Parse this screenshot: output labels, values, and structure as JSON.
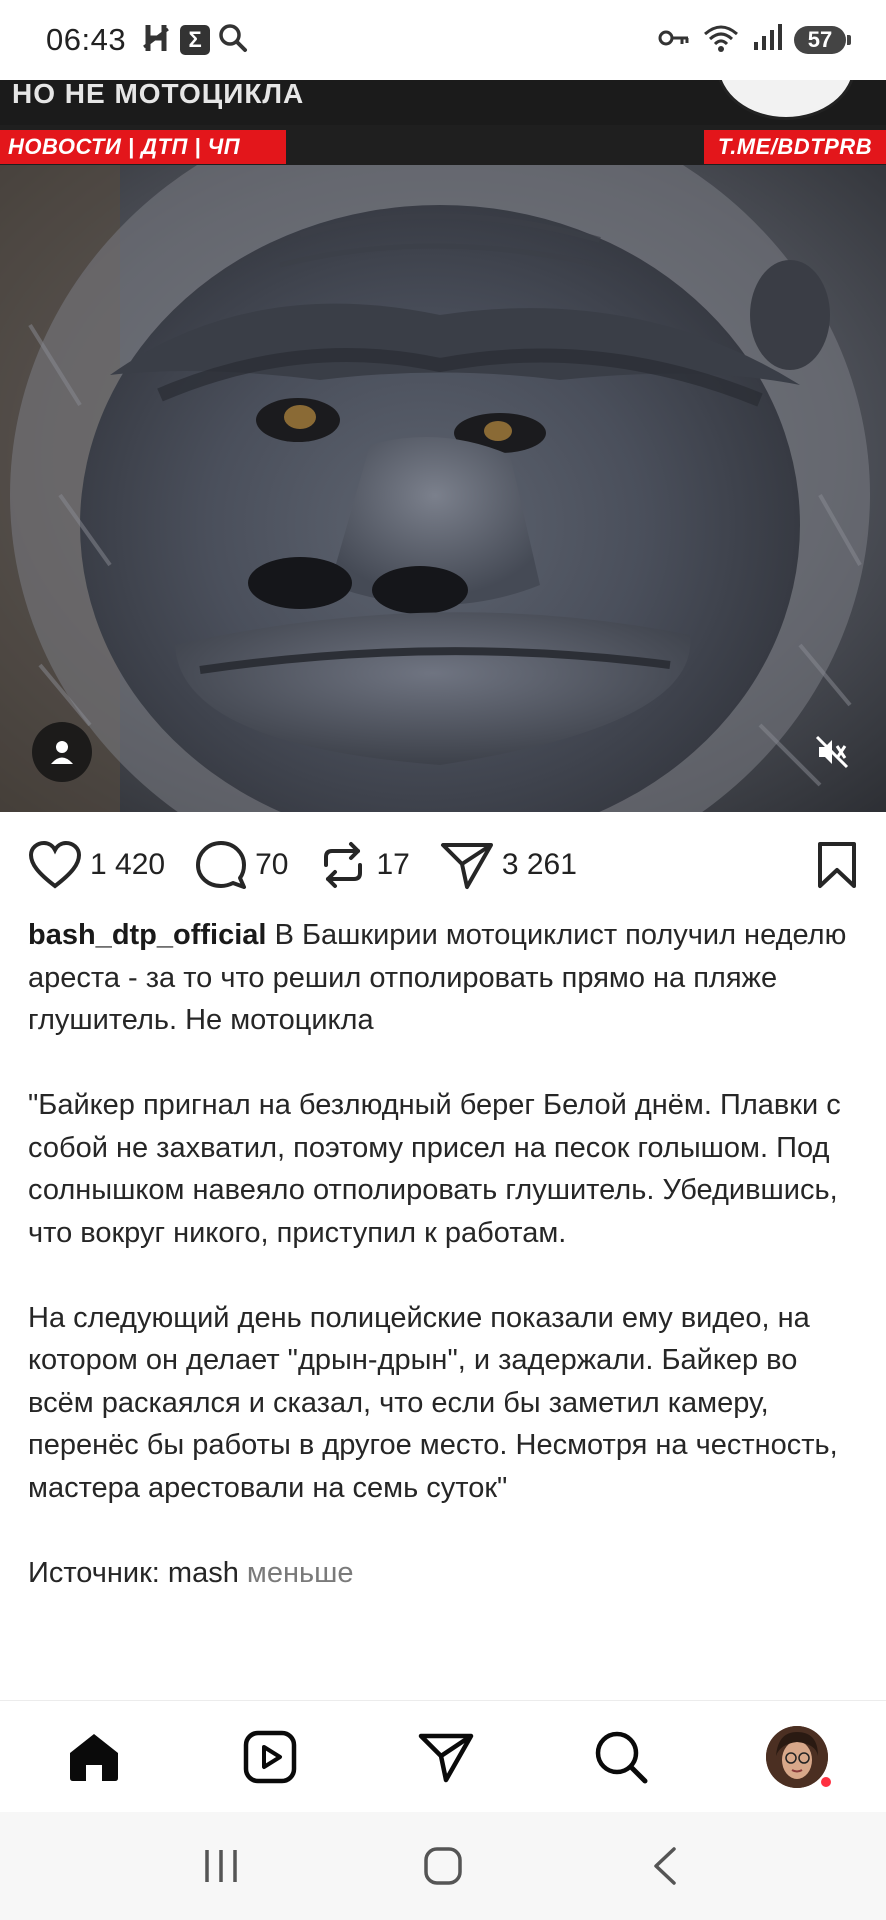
{
  "status_bar": {
    "time": "06:43",
    "battery": "57",
    "icons": [
      "h-icon",
      "sigma-icon",
      "search-icon",
      "key-icon",
      "wifi-icon",
      "signal-icon",
      "battery-icon"
    ]
  },
  "media": {
    "headline": "НО НЕ МОТОЦИКЛА",
    "tag_left": "НОВОСТИ | ДТП | ЧП",
    "tag_right": "T.ME/BDTPRB"
  },
  "actions": {
    "likes": "1 420",
    "comments": "70",
    "reposts": "17",
    "shares": "3 261"
  },
  "post": {
    "username": "bash_dtp_official",
    "caption_intro": "В Башкирии мотоциклист получил неделю ареста - за то что решил отполировать прямо на пляже глушитель. Не мотоцикла",
    "paragraph_2": "\"Байкер пригнал на безлюдный берег Белой днём. Плавки с собой не захватил, поэтому присел на песок голышом. Под солнышком навеяло отполировать глушитель. Убедившись, что вокруг никого, приступил к работам.",
    "paragraph_3": "На следующий день полицейские показали ему видео, на котором он делает \"дрын-дрын\", и задержали. Байкер во всём раскаялся и сказал, что если бы заметил камеру, перенёс бы работы в другое место. Несмотря на честность, мастера арестовали на семь суток\"",
    "source": "Источник: mash",
    "less_label": "меньше"
  },
  "colors": {
    "accent_red": "#e3161b",
    "notification_dot": "#ff3040"
  }
}
